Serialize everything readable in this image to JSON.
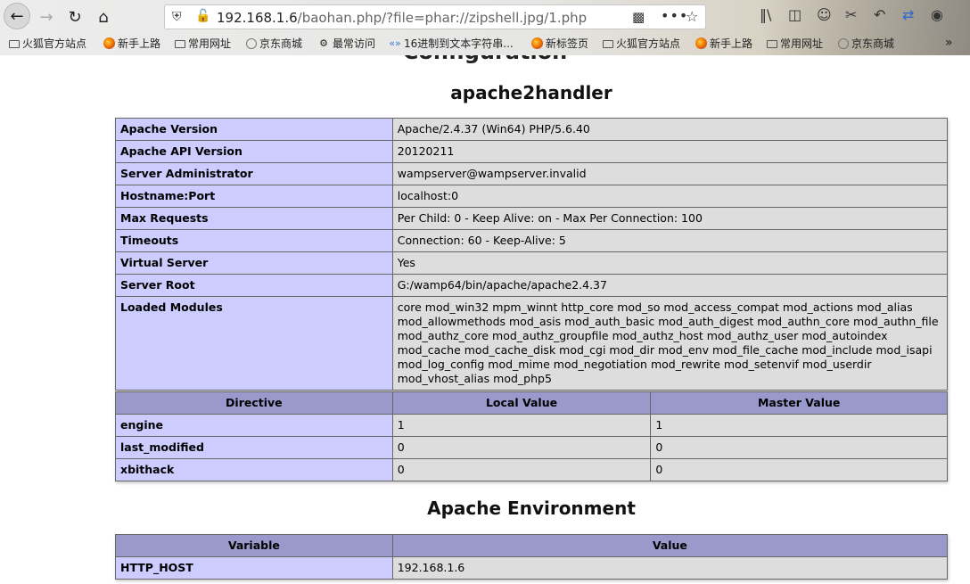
{
  "browser": {
    "url_host": "192.168.1.6",
    "url_path": "/baohan.php/?file=phar://zipshell.jpg/1.php",
    "bookmarks": [
      "火狐官方站点",
      "新手上路",
      "常用网址",
      "京东商城",
      "最常访问",
      "16进制到文本字符串...",
      "新标签页",
      "火狐官方站点",
      "新手上路",
      "常用网址",
      "京东商城"
    ]
  },
  "page": {
    "title": "Configuration",
    "apache2handler": {
      "heading": "apache2handler",
      "rows": [
        {
          "k": "Apache Version",
          "v": "Apache/2.4.37 (Win64) PHP/5.6.40"
        },
        {
          "k": "Apache API Version",
          "v": "20120211"
        },
        {
          "k": "Server Administrator",
          "v": "wampserver@wampserver.invalid"
        },
        {
          "k": "Hostname:Port",
          "v": "localhost:0"
        },
        {
          "k": "Max Requests",
          "v": "Per Child: 0 - Keep Alive: on - Max Per Connection: 100"
        },
        {
          "k": "Timeouts",
          "v": "Connection: 60 - Keep-Alive: 5"
        },
        {
          "k": "Virtual Server",
          "v": "Yes"
        },
        {
          "k": "Server Root",
          "v": "G:/wamp64/bin/apache/apache2.4.37"
        },
        {
          "k": "Loaded Modules",
          "v": "core mod_win32 mpm_winnt http_core mod_so mod_access_compat mod_actions mod_alias mod_allowmethods mod_asis mod_auth_basic mod_auth_digest mod_authn_core mod_authn_file mod_authz_core mod_authz_groupfile mod_authz_host mod_authz_user mod_autoindex mod_cache mod_cache_disk mod_cgi mod_dir mod_env mod_file_cache mod_include mod_isapi mod_log_config mod_mime mod_negotiation mod_rewrite mod_setenvif mod_userdir mod_vhost_alias mod_php5"
        }
      ]
    },
    "directives": {
      "headers": [
        "Directive",
        "Local Value",
        "Master Value"
      ],
      "rows": [
        {
          "d": "engine",
          "l": "1",
          "m": "1"
        },
        {
          "d": "last_modified",
          "l": "0",
          "m": "0"
        },
        {
          "d": "xbithack",
          "l": "0",
          "m": "0"
        }
      ]
    },
    "environment": {
      "heading": "Apache Environment",
      "headers": [
        "Variable",
        "Value"
      ],
      "rows": [
        {
          "k": "HTTP_HOST",
          "v": "192.168.1.6"
        }
      ]
    }
  }
}
